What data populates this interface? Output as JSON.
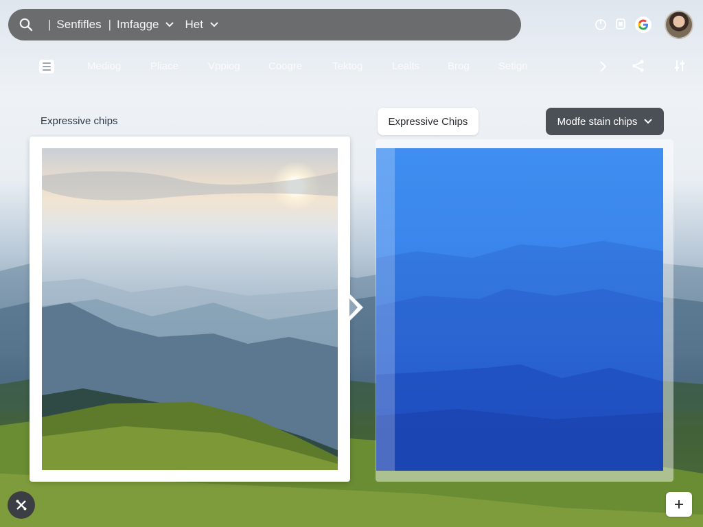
{
  "search": {
    "separator": "|",
    "text_primary": "Senfifles",
    "text_secondary": "Imfagge",
    "text_tertiary": "Het",
    "icon": "search-icon",
    "dropdown_icon": "chevron-down-icon"
  },
  "top_right": {
    "icons": [
      "power-icon",
      "tablet-icon",
      "google-icon",
      "avatar"
    ]
  },
  "nav": {
    "menu_icon": "menu-icon",
    "items": [
      "Mediog",
      "Pliace",
      "Vppiog",
      "Coogre",
      "Tektog",
      "Lealts",
      "Brog",
      "Setign"
    ],
    "more_icon": "chevron-right-icon",
    "share_icon": "share-icon",
    "settings_icon": "tune-icon"
  },
  "left_panel": {
    "label": "Expressive chips"
  },
  "right_panel": {
    "chip_white": "Expressive Chips",
    "chip_dark": "Modfe stain chips"
  },
  "bottom": {
    "tools_icon": "tools-icon",
    "add_icon": "plus-icon"
  },
  "colors": {
    "searchbar_bg": "#505050",
    "chip_dark_bg": "#4b4f56",
    "blue_overlay": "#2f72df",
    "white": "#ffffff"
  }
}
